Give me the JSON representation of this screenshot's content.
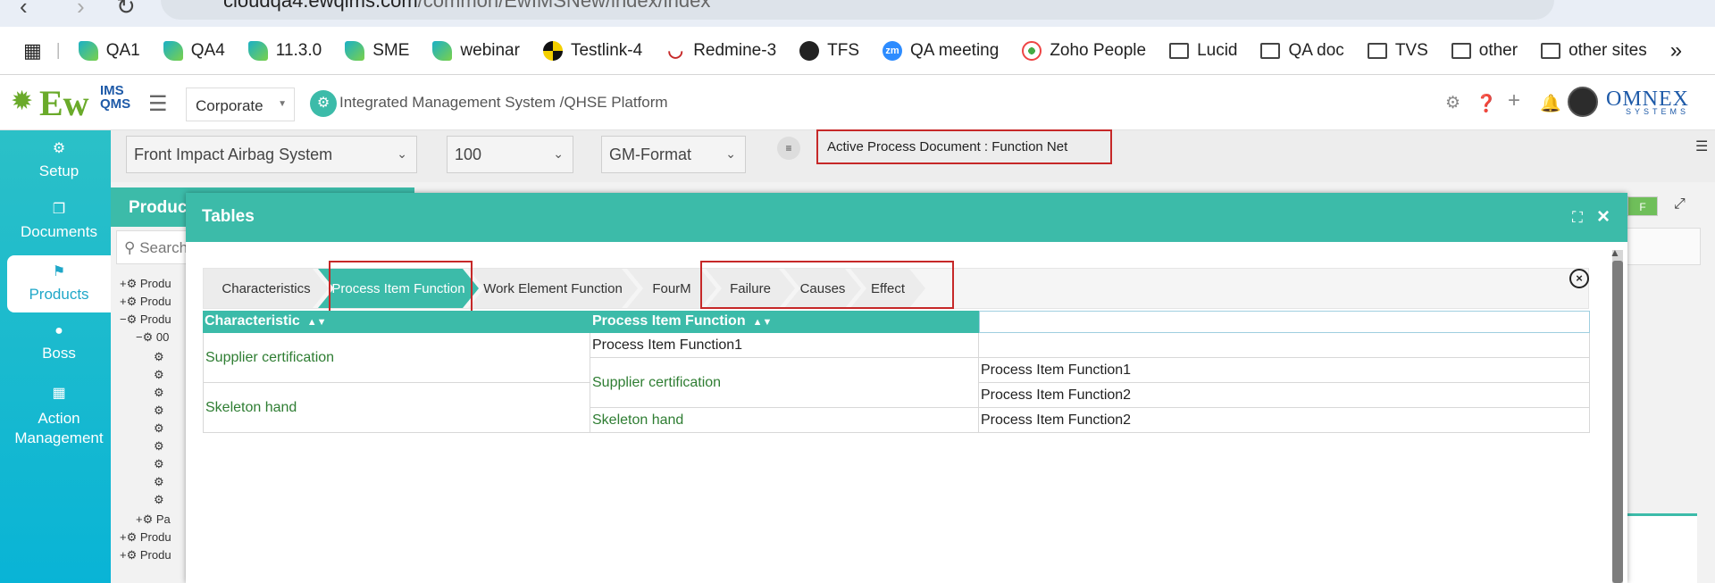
{
  "browser": {
    "url_host": "cloudqa4.ewqims.com",
    "url_path": "/common/EwIMSNew/index/index",
    "bookmarks": [
      {
        "label": "QA1",
        "icon": "feather-icon"
      },
      {
        "label": "QA4",
        "icon": "feather-icon"
      },
      {
        "label": "11.3.0",
        "icon": "feather-icon"
      },
      {
        "label": "SME",
        "icon": "feather-icon"
      },
      {
        "label": "webinar",
        "icon": "feather-icon"
      },
      {
        "label": "Testlink-4",
        "icon": "testlink-icon"
      },
      {
        "label": "Redmine-3",
        "icon": "redmine-icon"
      },
      {
        "label": "TFS",
        "icon": "globe-icon"
      },
      {
        "label": "QA meeting",
        "icon": "zoom-icon"
      },
      {
        "label": "Zoho People",
        "icon": "zoho-icon"
      },
      {
        "label": "Lucid",
        "icon": "folder-icon"
      },
      {
        "label": "QA doc",
        "icon": "folder-icon"
      },
      {
        "label": "TVS",
        "icon": "folder-icon"
      },
      {
        "label": "other",
        "icon": "folder-icon"
      },
      {
        "label": "other sites",
        "icon": "folder-icon"
      }
    ],
    "zoom_badge": "zm",
    "more": "»"
  },
  "header": {
    "logo_main": "Ew",
    "logo_ims": "IMS",
    "logo_qms": "QMS",
    "site_select": "Corporate",
    "platform_title": "Integrated Management System /QHSE Platform",
    "brand": "OMNEX",
    "brand_sub": "SYSTEMS"
  },
  "sidebar": {
    "items": [
      {
        "label": "Setup",
        "icon": "gears-icon"
      },
      {
        "label": "Documents",
        "icon": "documents-icon"
      },
      {
        "label": "Products",
        "icon": "products-icon"
      },
      {
        "label": "Boss",
        "icon": "user-icon"
      },
      {
        "label": "Action Management",
        "icon": "building-icon"
      }
    ]
  },
  "filters": {
    "product": "Front Impact Airbag System",
    "revision": "100",
    "format": "GM-Format",
    "active_document": "Active Process Document : Function Net"
  },
  "background": {
    "panel_title": "Produc",
    "search_placeholder": "Search",
    "tree": [
      "Produ",
      "Produ",
      "Produ",
      "00",
      "Pa",
      "Produ",
      "Produ"
    ],
    "f_badge": "F"
  },
  "modal": {
    "title": "Tables",
    "steps": [
      "Characteristics",
      "Process Item Function",
      "Work Element Function",
      "FourM",
      "Failure",
      "Causes",
      "Effect"
    ],
    "active_step": "Process Item Function",
    "table": {
      "headers": [
        "Characteristic",
        "Process Item Function",
        ""
      ],
      "col1": [
        "Supplier certification",
        "Skeleton hand"
      ],
      "col2": [
        "Process Item Function1",
        "Supplier certification",
        "Skeleton hand"
      ],
      "col3": [
        "",
        "Process Item Function1",
        "Process Item Function2",
        "Process Item Function2"
      ]
    }
  }
}
